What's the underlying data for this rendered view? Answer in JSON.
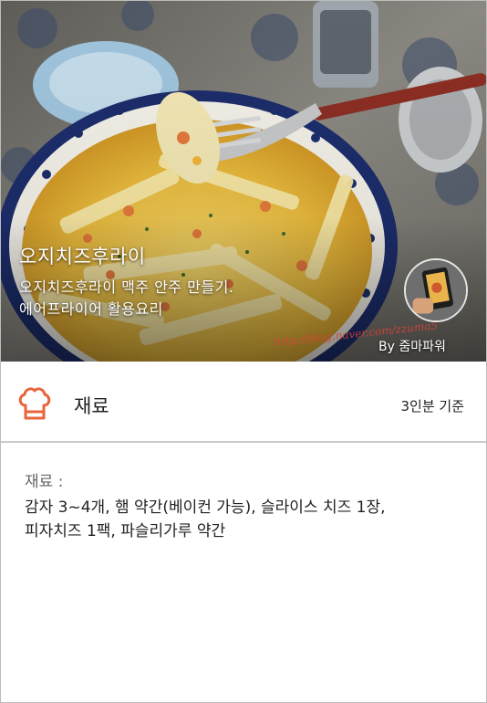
{
  "hero": {
    "title": "오지치즈후라이",
    "subtitle_lines": [
      "오지치즈후라이 맥주 안주 만들기.",
      "에어프라이어 활용요리"
    ],
    "author_prefix": "By",
    "author_name": "줌마파워",
    "watermark": "http://blog.naver.com/zzuma5"
  },
  "ingredients": {
    "icon": "chef-hat-icon",
    "title": "재료",
    "serving": "3인분 기준",
    "label": "재료 :",
    "lines": [
      "감자 3~4개, 햄 약간(베이컨 가능), 슬라이스 치즈 1장,",
      "피자치즈 1팩, 파슬리가루 약간"
    ]
  },
  "colors": {
    "accent": "#e8643c",
    "divider": "#c9c9c9",
    "label_gray": "#666666"
  }
}
